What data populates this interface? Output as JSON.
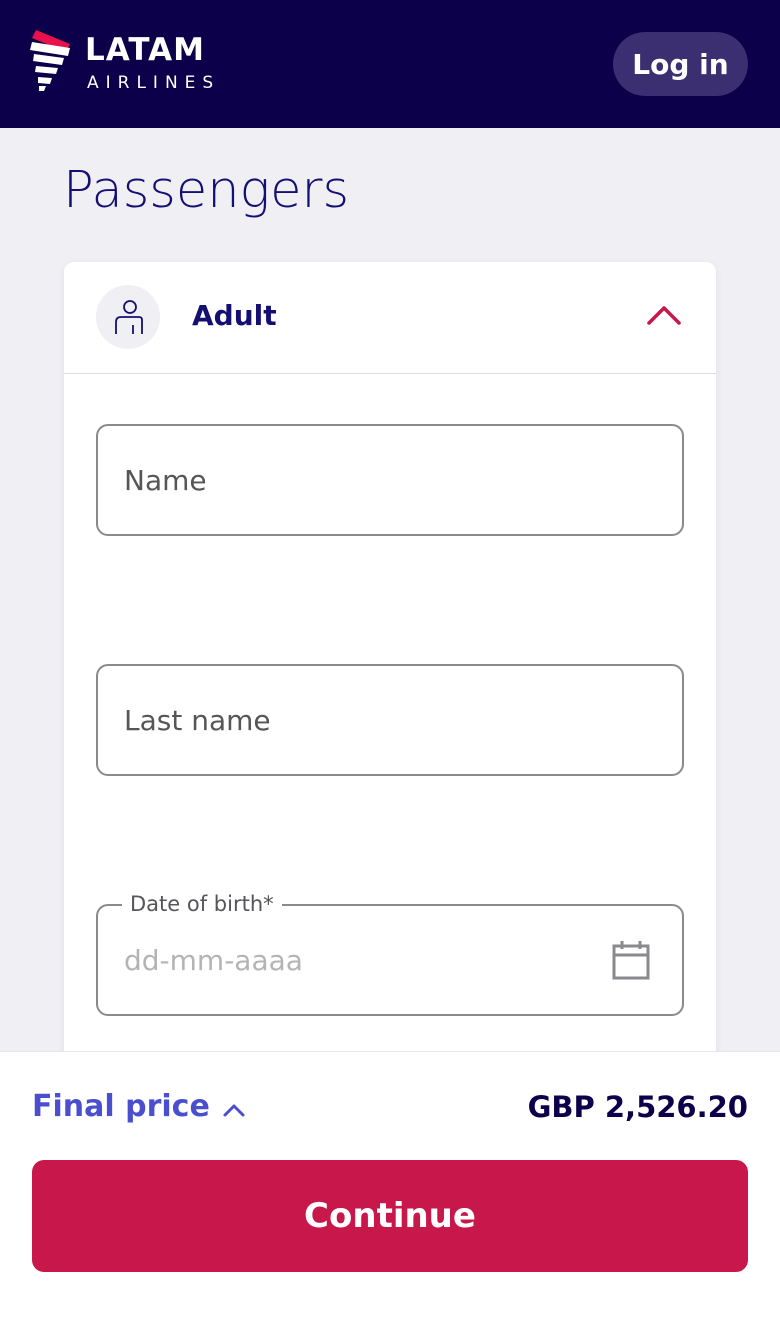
{
  "header": {
    "brand_name": "LATAM",
    "brand_sub": "AIRLINES",
    "login_label": "Log in",
    "background": "#0b0049",
    "brand_icon": "latam-logo-icon"
  },
  "page": {
    "title": "Passengers"
  },
  "passenger_card": {
    "type_label": "Adult",
    "avatar_icon": "person-icon",
    "collapse_icon": "chevron-up-icon",
    "fields": {
      "name": {
        "placeholder": "Name",
        "value": ""
      },
      "last_name": {
        "placeholder": "Last name",
        "value": ""
      },
      "date_of_birth": {
        "label": "Date of birth*",
        "placeholder": "dd-mm-aaaa",
        "value": "",
        "icon": "calendar-icon"
      }
    }
  },
  "footer": {
    "final_price_label": "Final price",
    "price": "GBP 2,526.20",
    "continue_label": "Continue",
    "accent_color": "#c8174a",
    "link_color": "#4a4fcf"
  }
}
